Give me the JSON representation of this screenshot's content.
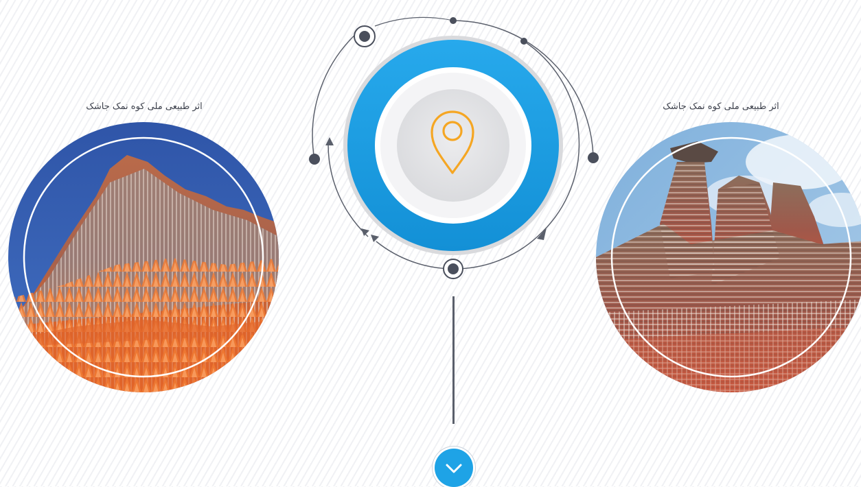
{
  "cards": [
    {
      "caption": "اثر طبیعی ملی کوه نمک جاشک",
      "image": "red-striped-salt-mountain-blue-sky"
    },
    {
      "caption": "اثر طبیعی ملی کوه نمک جاشک",
      "image": "layered-salt-rock-towers-cloudy-sky"
    }
  ],
  "center": {
    "icon": "location-pin-icon",
    "ring_color": "#1ea3e6",
    "pin_color": "#f5a623"
  },
  "scroll_button": {
    "icon": "chevron-down-icon",
    "color": "#1ea3e6"
  }
}
